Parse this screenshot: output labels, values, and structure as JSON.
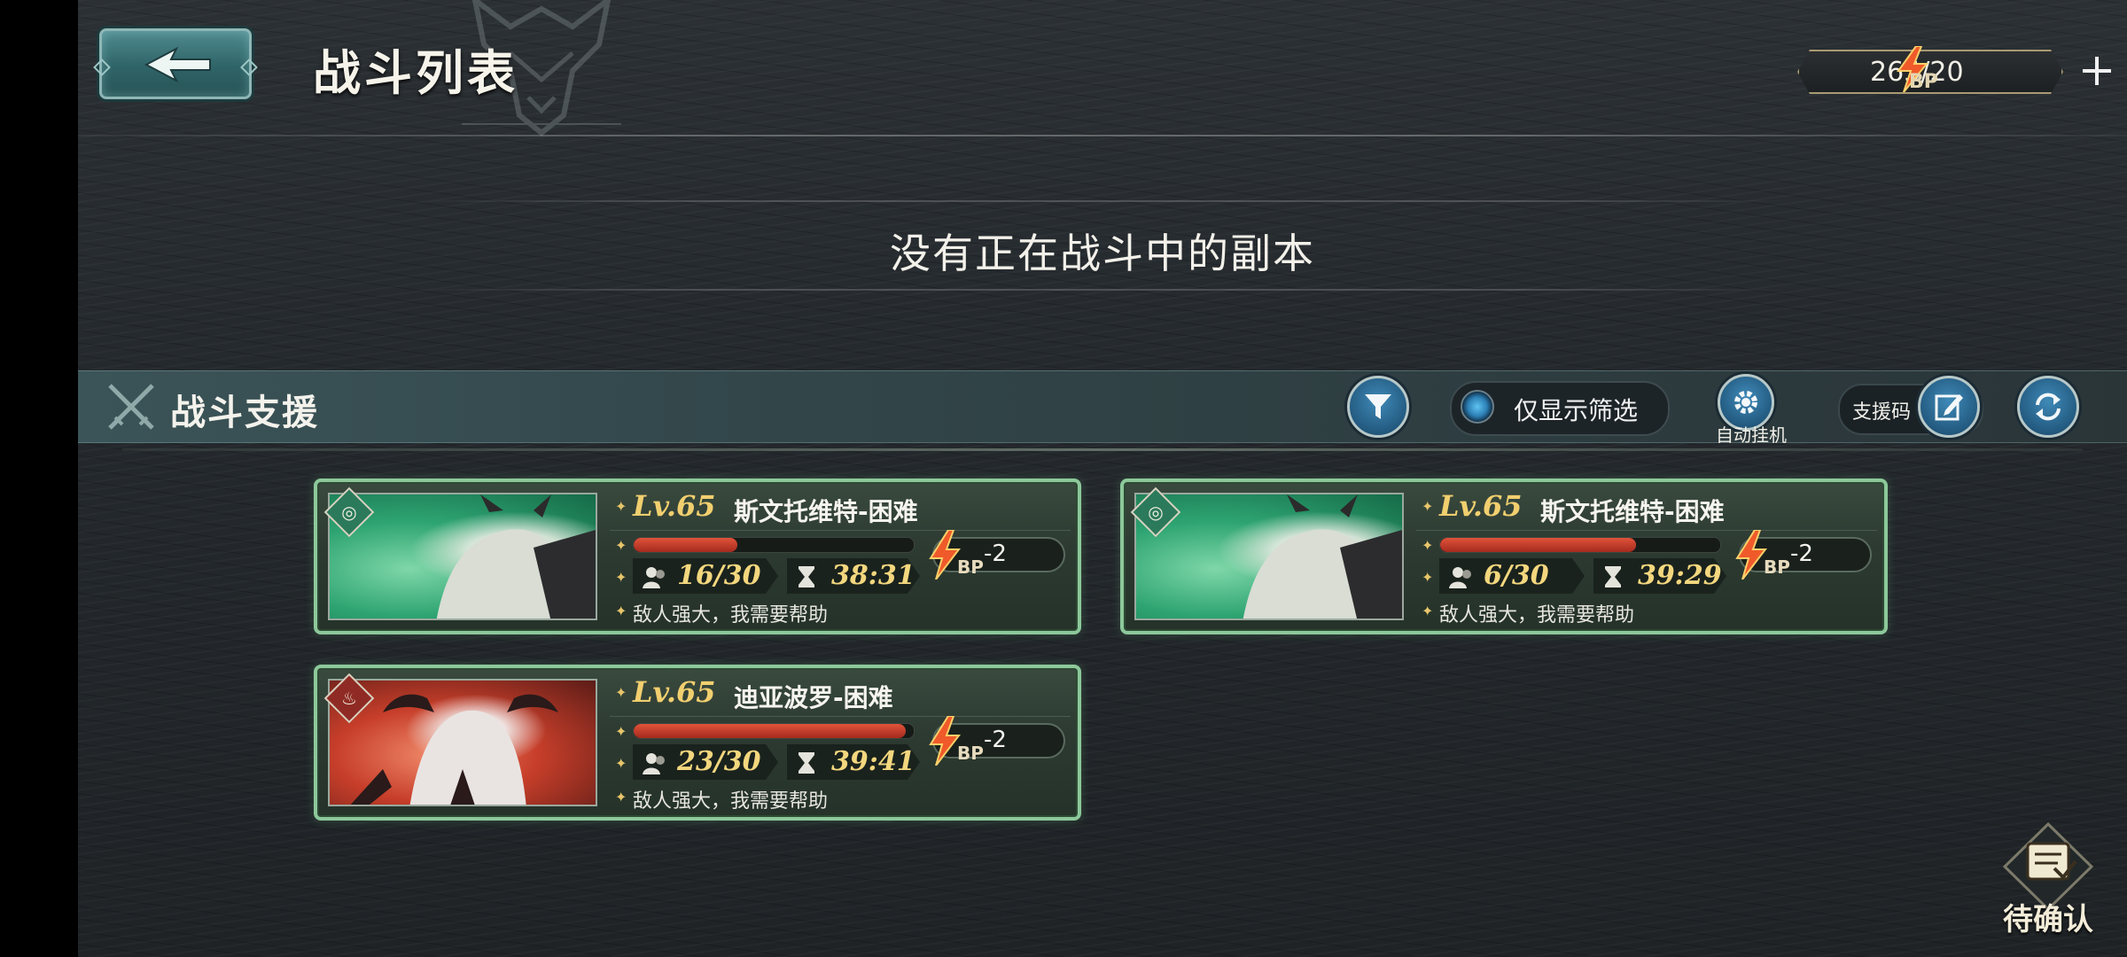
{
  "header": {
    "title": "战斗列表",
    "bp_value": "265/20",
    "bp_label": "BP"
  },
  "banner": {
    "no_battle_text": "没有正在战斗中的副本"
  },
  "support": {
    "title": "战斗支援",
    "filter_toggle_label": "仅显示筛选",
    "auto_label": "自动挂机",
    "code_label": "支援码"
  },
  "cards": [
    {
      "level": "Lv.65",
      "boss": "斯文托维特-困难",
      "element": "wind",
      "hp_fraction": 0.37,
      "players": "16/30",
      "time": "38:31",
      "cost": "-2",
      "bp_label": "BP",
      "message": "敌人强大，我需要帮助"
    },
    {
      "level": "Lv.65",
      "boss": "斯文托维特-困难",
      "element": "wind",
      "hp_fraction": 0.7,
      "players": "6/30",
      "time": "39:29",
      "cost": "-2",
      "bp_label": "BP",
      "message": "敌人强大，我需要帮助"
    },
    {
      "level": "Lv.65",
      "boss": "迪亚波罗-困难",
      "element": "fire",
      "hp_fraction": 0.97,
      "players": "23/30",
      "time": "39:41",
      "cost": "-2",
      "bp_label": "BP",
      "message": "敌人强大，我需要帮助"
    }
  ],
  "pending": {
    "label": "待确认"
  },
  "colors": {
    "card_border": "#8cc89a",
    "hp_bar": "#e0533a",
    "level_gold": "#f1cf6f",
    "button_blue": "#2f7fb0"
  }
}
